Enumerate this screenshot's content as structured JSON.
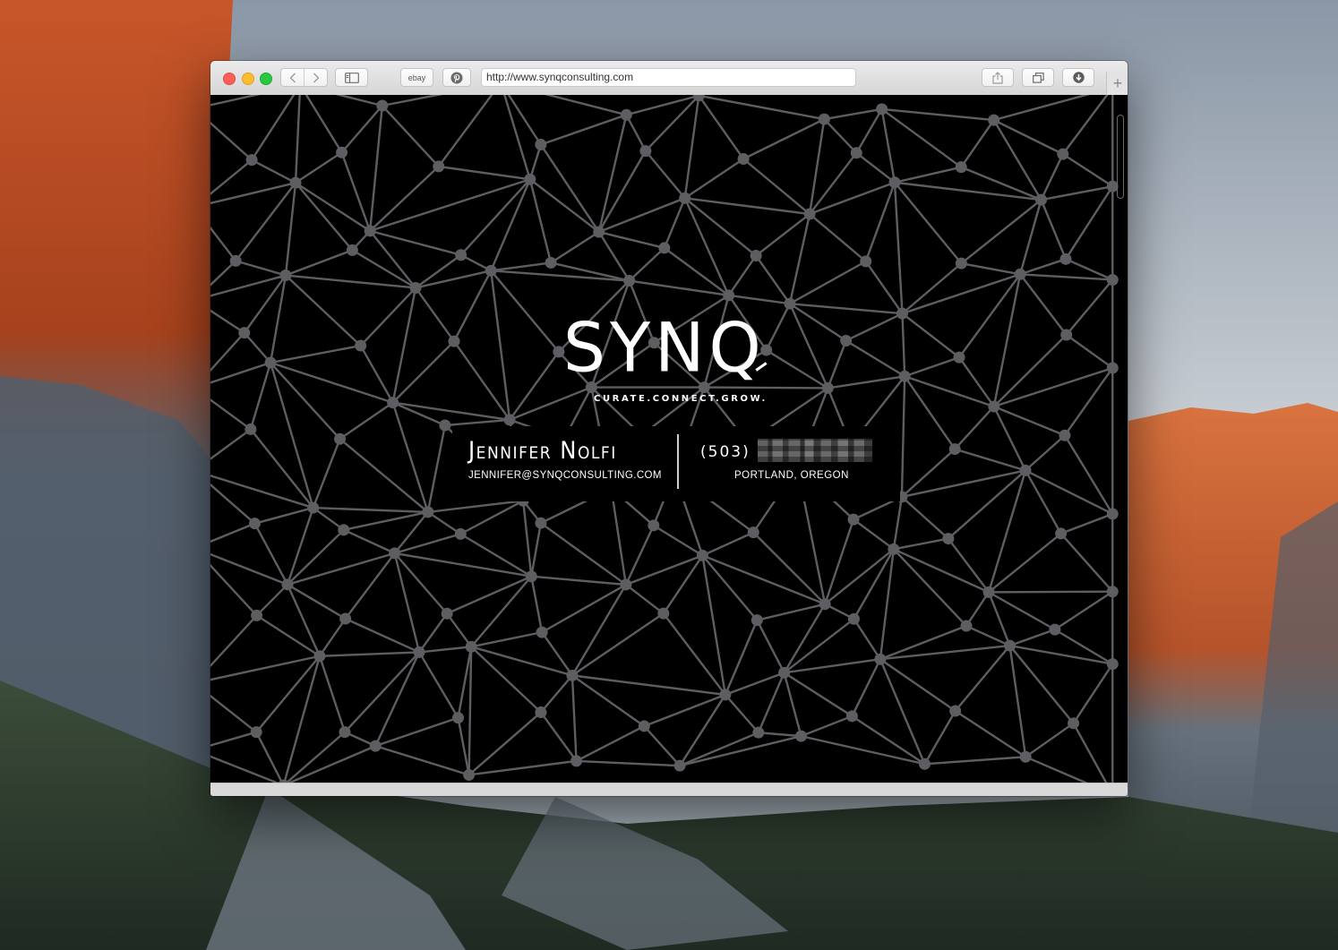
{
  "browser": {
    "url": "http://www.synqconsulting.com",
    "favorites": [
      {
        "label": "ebay",
        "icon": "ebay-favorite"
      },
      {
        "label": "",
        "icon": "pinterest-icon"
      }
    ],
    "toolbar_icons": [
      "back-icon",
      "forward-icon",
      "sidebar-icon",
      "share-icon",
      "tabs-icon",
      "download-icon",
      "new-tab-plus-icon"
    ]
  },
  "site": {
    "logo": "SYNQ",
    "tagline": "CURATE.CONNECT.GROW.",
    "contact": {
      "name": "Jennifer Nolfi",
      "email": "JENNIFER@SYNQCONSULTING.COM",
      "phone_area": "(503)",
      "phone_rest_redacted": true,
      "location": "PORTLAND, OREGON"
    }
  },
  "colors": {
    "page_background": "#000000",
    "network_lines": "#5e5e62",
    "text": "#ffffff",
    "close": "#fc5f57",
    "minimize": "#fdbc2e",
    "maximize": "#28c840"
  }
}
